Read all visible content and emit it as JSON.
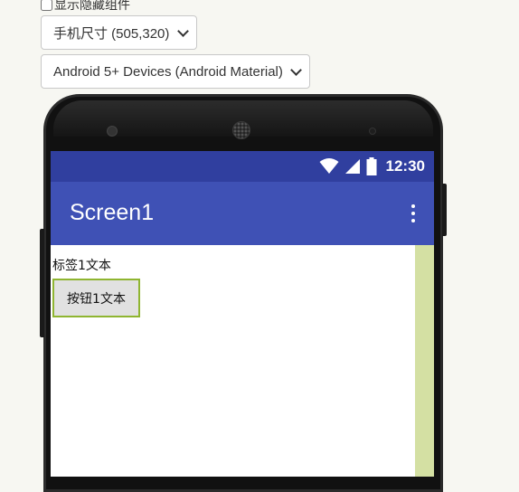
{
  "controls": {
    "show_hidden_label": "显示隐藏组件",
    "show_hidden_checked": false,
    "size_select_value": "手机尺寸 (505,320)",
    "theme_select_value": "Android 5+ Devices (Android Material)"
  },
  "phone": {
    "status_bar": {
      "time": "12:30",
      "icons": [
        "wifi-icon",
        "cell-signal-icon",
        "battery-icon"
      ]
    },
    "app_bar": {
      "title": "Screen1",
      "menu_icon": "more-vertical-icon"
    },
    "components": {
      "label_text": "标签1文本",
      "button_text": "按钮1文本"
    }
  },
  "colors": {
    "status_bar": "#303f9f",
    "app_bar": "#3f51b5",
    "selection_border": "#8fb531",
    "side_strip": "#d4e0a3"
  }
}
